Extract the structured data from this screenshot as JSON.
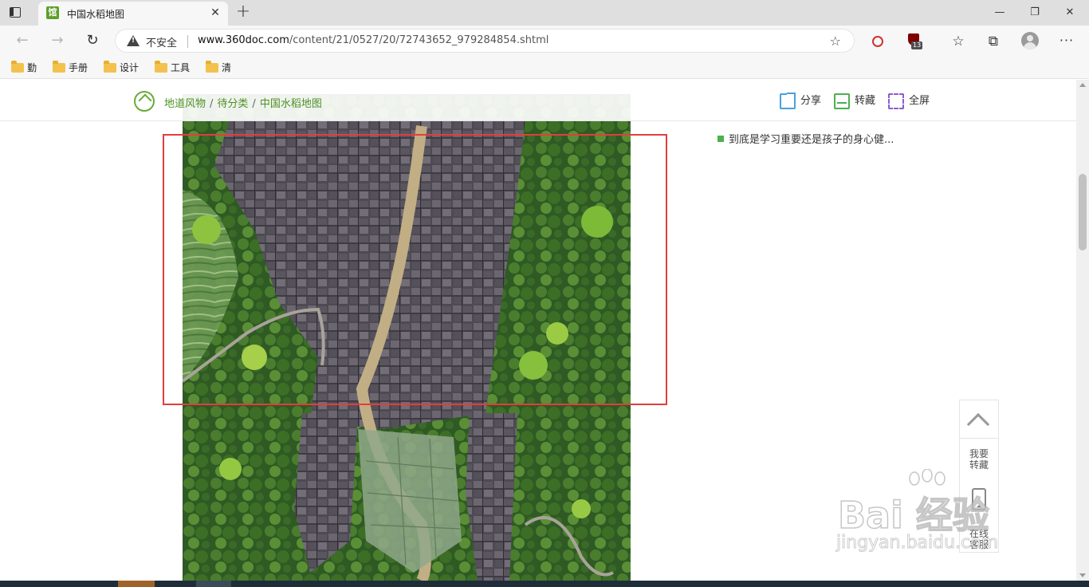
{
  "browser": {
    "tab_title": "中国水稻地图",
    "favicon_text": "馆",
    "close_glyph": "✕",
    "new_tab_glyph": "+",
    "window_controls": {
      "minimize": "—",
      "maximize": "❐",
      "close": "✕"
    }
  },
  "navbar": {
    "back_glyph": "←",
    "forward_glyph": "→",
    "reload_glyph": "↻",
    "security_label": "不安全",
    "url_host": "www.360doc.com",
    "url_path": "/content/21/0527/20/72743652_979284854.shtml",
    "extension_badge": "13",
    "add_favorite_glyph": "☆",
    "favorites_glyph": "☆",
    "collections_glyph": "⧉",
    "more_glyph": "···"
  },
  "bookmarks": [
    {
      "label": "勤"
    },
    {
      "label": "手册"
    },
    {
      "label": "设计"
    },
    {
      "label": "工具"
    },
    {
      "label": "清"
    }
  ],
  "page": {
    "breadcrumb": {
      "level1": "地道风物",
      "level2": "待分类",
      "current": "中国水稻地图",
      "separator": "/"
    },
    "actions": {
      "share": "分享",
      "save": "转藏",
      "fullscreen": "全屏"
    },
    "related": [
      {
        "title": "到底是学习重要还是孩子的身心健..."
      }
    ],
    "float_panel": {
      "save_text_1": "我要",
      "save_text_2": "转藏",
      "service_text_1": "在线",
      "service_text_2": "客服"
    },
    "watermark": {
      "main": "Bai 经验",
      "sub": "jingyan.baidu.com"
    }
  },
  "colors": {
    "accent_green": "#4d8f25",
    "highlight_red": "#e33d3d",
    "share_blue": "#4aa0e0",
    "fullscreen_purple": "#8e5bd0"
  },
  "icons": [
    "tab-actions-icon",
    "favicon",
    "warning-icon",
    "add-favorite-icon",
    "extension-icon",
    "ublock-icon",
    "favorites-icon",
    "collections-icon",
    "profile-avatar",
    "more-icon",
    "folder-icon",
    "home-icon",
    "share-icon",
    "save-icon",
    "fullscreen-icon",
    "scroll-top-icon",
    "phone-icon"
  ]
}
